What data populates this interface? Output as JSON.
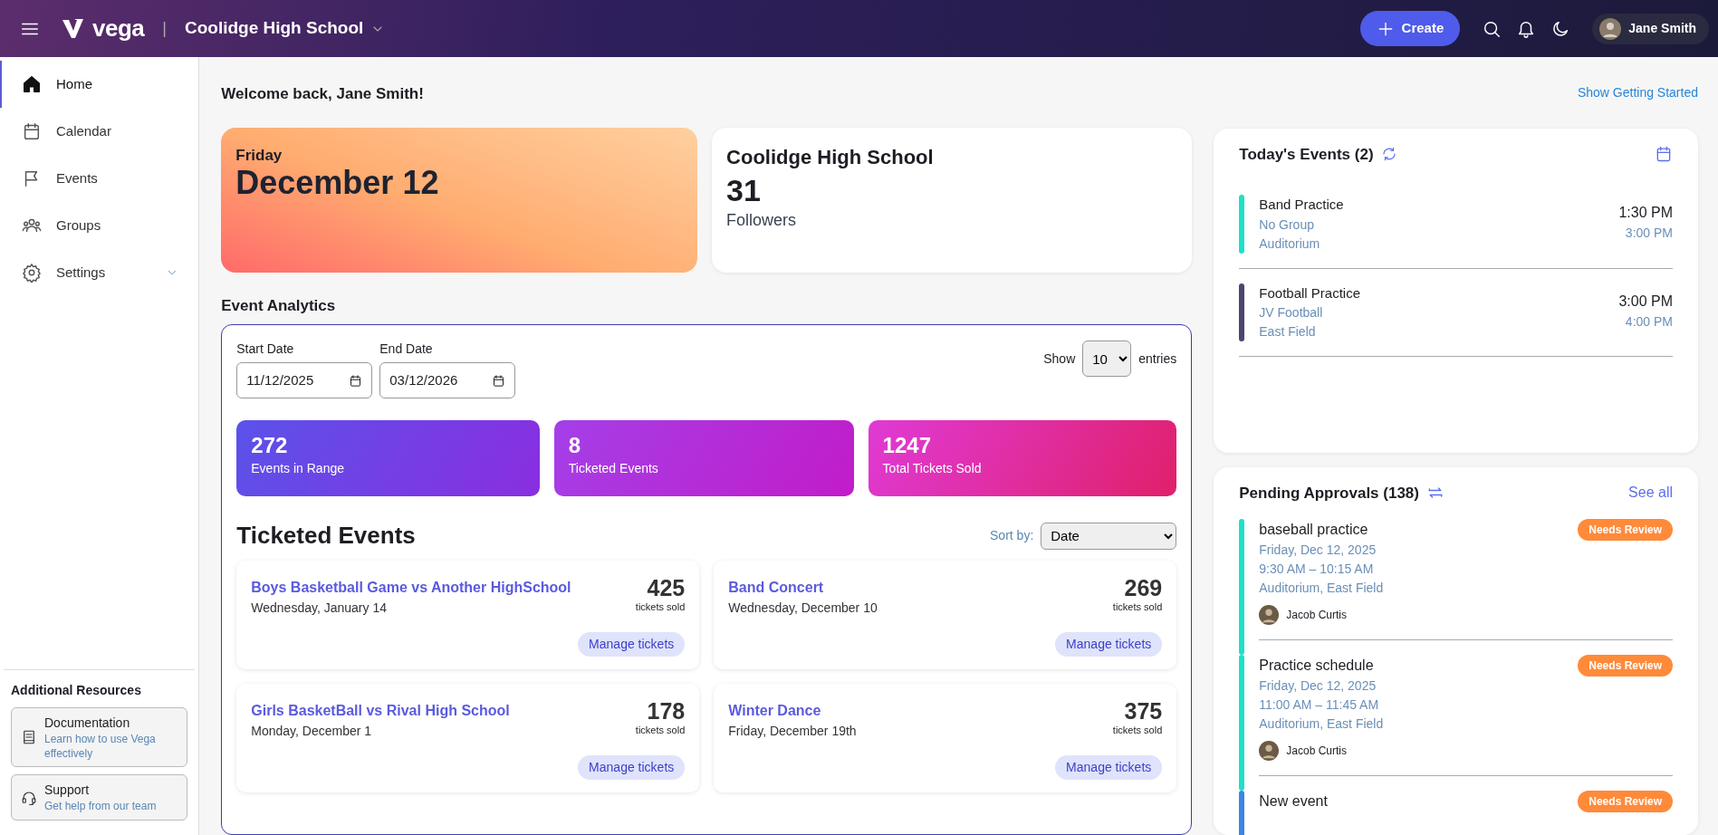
{
  "topbar": {
    "brand": "vega",
    "separator": "|",
    "school": "Coolidge High School",
    "create_label": "Create",
    "user_name": "Jane Smith"
  },
  "sidebar": {
    "items": [
      {
        "label": "Home",
        "kind": "home",
        "selected": true,
        "expandable": false
      },
      {
        "label": "Calendar",
        "kind": "calendar",
        "selected": false,
        "expandable": false
      },
      {
        "label": "Events",
        "kind": "events",
        "selected": false,
        "expandable": false
      },
      {
        "label": "Groups",
        "kind": "groups",
        "selected": false,
        "expandable": false
      },
      {
        "label": "Settings",
        "kind": "settings",
        "selected": false,
        "expandable": true
      }
    ],
    "resources_title": "Additional Resources",
    "resources": [
      {
        "title": "Documentation",
        "subtitle": "Learn how to use Vega effectively",
        "kind": "documentation"
      },
      {
        "title": "Support",
        "subtitle": "Get help from our team",
        "kind": "support"
      }
    ]
  },
  "welcome": "Welcome back, Jane Smith!",
  "getting_started_link": "Show Getting Started",
  "date_card": {
    "weekday": "Friday",
    "date": "December 12"
  },
  "school_card": {
    "name": "Coolidge High School",
    "count": "31",
    "label": "Followers"
  },
  "analytics": {
    "title": "Event Analytics",
    "start_label": "Start Date",
    "start_value": "11/12/2025",
    "end_label": "End Date",
    "end_value": "03/12/2026",
    "show_label": "Show",
    "show_value": "10",
    "entries_label": "entries",
    "stats": [
      {
        "value": "272",
        "label": "Events in Range",
        "kind": "events"
      },
      {
        "value": "8",
        "label": "Ticketed Events",
        "kind": "ticketed"
      },
      {
        "value": "1247",
        "label": "Total Tickets Sold",
        "kind": "sold"
      }
    ]
  },
  "ticketed": {
    "title": "Ticketed Events",
    "sort_label": "Sort by:",
    "sort_value": "Date",
    "events": [
      {
        "name": "Boys Basketball Game vs Another HighSchool",
        "date": "Wednesday, January 14",
        "count": "425",
        "count_label": "tickets sold",
        "action": "Manage tickets"
      },
      {
        "name": "Band Concert",
        "date": "Wednesday, December 10",
        "count": "269",
        "count_label": "tickets sold",
        "action": "Manage tickets"
      },
      {
        "name": "Girls BasketBall vs Rival High School",
        "date": "Monday, December 1",
        "count": "178",
        "count_label": "tickets sold",
        "action": "Manage tickets"
      },
      {
        "name": "Winter Dance",
        "date": "Friday, December 19th",
        "count": "375",
        "count_label": "tickets sold",
        "action": "Manage tickets"
      }
    ]
  },
  "todays_events": {
    "title": "Today's Events (2)",
    "items": [
      {
        "title": "Band Practice",
        "group": "No Group",
        "location": "Auditorium",
        "start": "1:30 PM",
        "end": "3:00 PM",
        "color": "#1fe0c8"
      },
      {
        "title": "Football Practice",
        "group": "JV Football",
        "location": "East Field",
        "start": "3:00 PM",
        "end": "4:00 PM",
        "color": "#4a4670"
      }
    ]
  },
  "pending": {
    "title": "Pending Approvals (138)",
    "see_all": "See all",
    "items": [
      {
        "title": "baseball practice",
        "date": "Friday, Dec 12, 2025",
        "time": "9:30 AM – 10:15 AM",
        "location": "Auditorium, East Field",
        "requester": "Jacob Curtis",
        "badge": "Needs Review",
        "color": "#1fe0c8"
      },
      {
        "title": "Practice schedule",
        "date": "Friday, Dec 12, 2025",
        "time": "11:00 AM – 11:45 AM",
        "location": "Auditorium, East Field",
        "requester": "Jacob Curtis",
        "badge": "Needs Review",
        "color": "#1fe0c8"
      },
      {
        "title": "New event",
        "badge": "Needs Review",
        "color": "#3a86e8"
      }
    ]
  }
}
